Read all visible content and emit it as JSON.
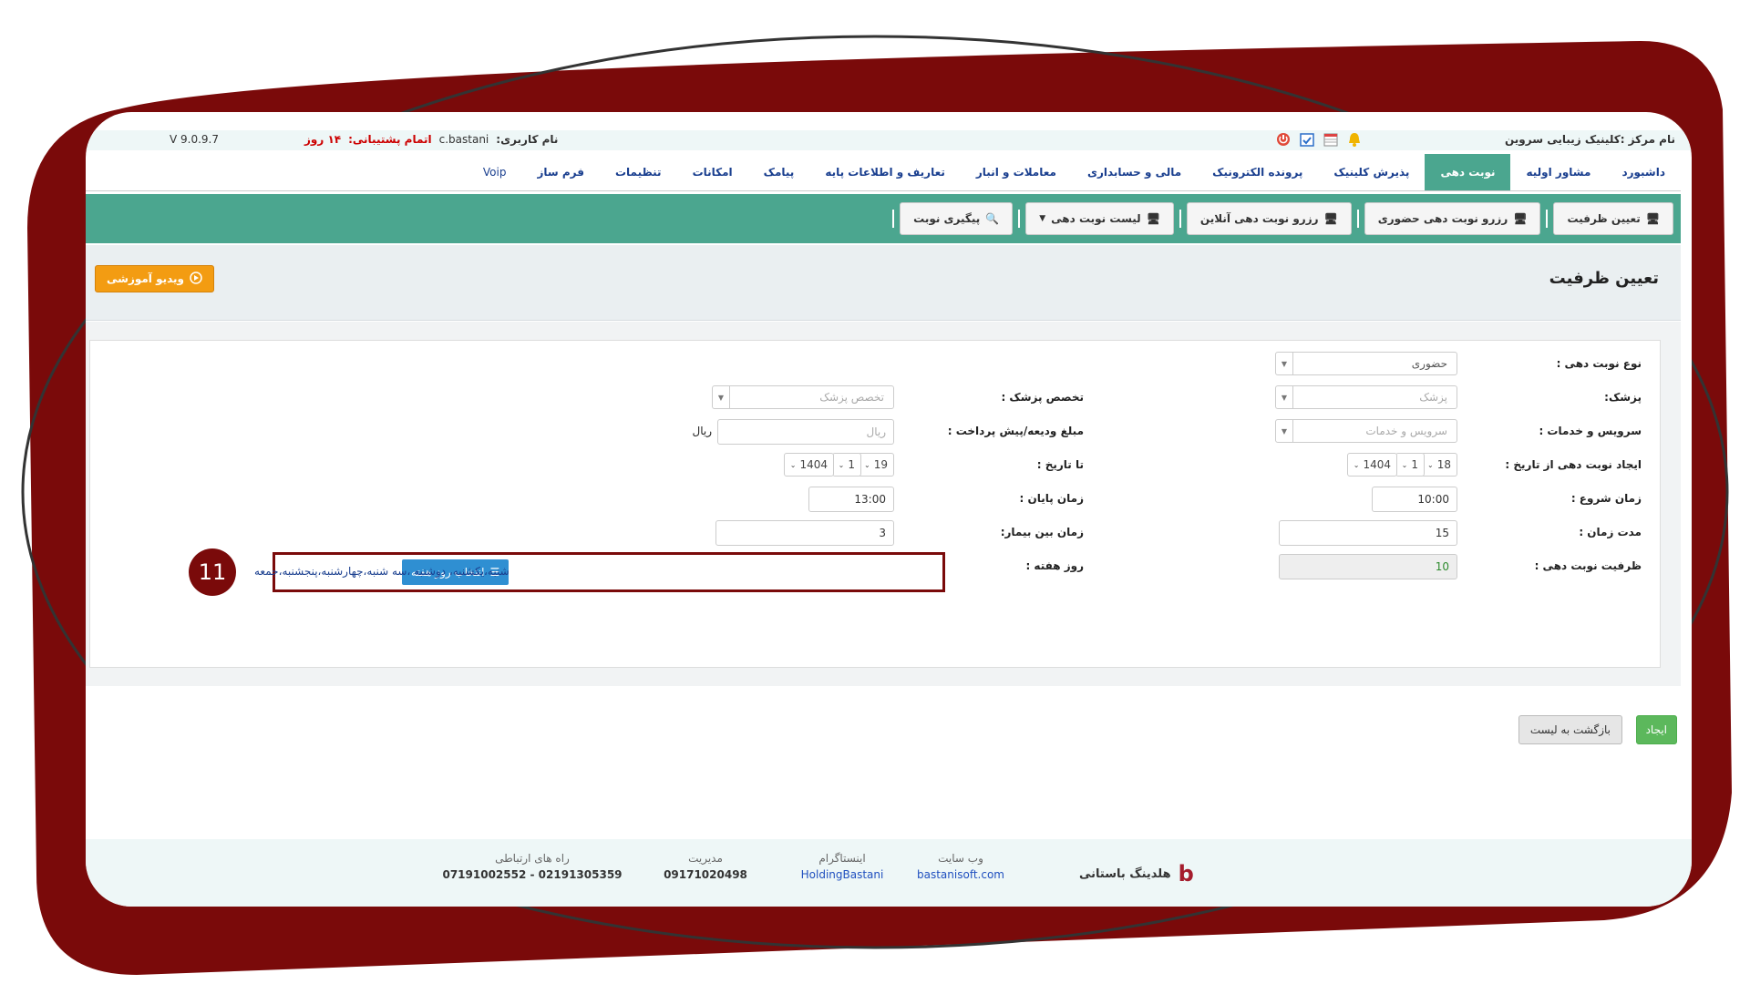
{
  "topbar": {
    "center_label": "نام مرکز :کلینیک زیبایی سروین",
    "user_label": "نام کاربری:",
    "username": "c.bastani",
    "support_label": "اتمام پشتیبانی:",
    "support_value": "۱۴ روز",
    "version": "V 9.0.9.7"
  },
  "main_nav": [
    {
      "label": "داشبورد"
    },
    {
      "label": "مشاور اولیه"
    },
    {
      "label": "نوبت دهی"
    },
    {
      "label": "پذیرش کلینیک"
    },
    {
      "label": "پرونده الکترونیک"
    },
    {
      "label": "مالی و حسابداری"
    },
    {
      "label": "معاملات و انبار"
    },
    {
      "label": "تعاریف و اطلاعات پایه"
    },
    {
      "label": "پیامک"
    },
    {
      "label": "امکانات"
    },
    {
      "label": "تنظیمات"
    },
    {
      "label": "فرم ساز"
    },
    {
      "label": "Voip"
    }
  ],
  "sub_nav": [
    {
      "label": "تعیین ظرفیت"
    },
    {
      "label": "رزرو نوبت دهی حضوری"
    },
    {
      "label": "رزرو نوبت دهی آنلاین"
    },
    {
      "label": "لیست نوبت دهی"
    },
    {
      "label": "پیگیری نوبت"
    }
  ],
  "page": {
    "title": "تعیین ظرفیت",
    "video_button": "ویدیو آموزشی"
  },
  "form": {
    "type_label": "نوع نوبت دهی :",
    "type_value": "حضوری",
    "doctor_label": "پزشک:",
    "doctor_placeholder": "پزشک",
    "specialty_label": "تخصص پزشک :",
    "specialty_placeholder": "تخصص پزشک",
    "services_label": "سرویس و خدمات :",
    "services_placeholder": "سرویس و خدمات",
    "deposit_label": "مبلغ ودیعه/پیش پرداخت :",
    "deposit_placeholder": "ریال",
    "deposit_unit": "ریال",
    "from_date_label": "ایجاد نوبت دهی از تاریخ :",
    "from_day": "18",
    "from_month": "1",
    "from_year": "1404",
    "to_date_label": "تا تاریخ :",
    "to_day": "19",
    "to_month": "1",
    "to_year": "1404",
    "start_time_label": "زمان شروع :",
    "start_time": "10:00",
    "end_time_label": "زمان پایان :",
    "end_time": "13:00",
    "duration_label": "مدت زمان :",
    "duration": "15",
    "between_label": "زمان بین بیمار:",
    "between": "3",
    "capacity_label": "ظرفیت نوبت دهی :",
    "capacity": "10",
    "weekday_label": "روز هفته :",
    "weekday_button": "انتخاب روز هفته",
    "weekday_selected": "شنبه،یکشنبه، دوشنبه ،سه شنبه،چهارشنبه،پنجشنبه،جمعه",
    "step_badge": "11"
  },
  "actions": {
    "create": "ایجاد",
    "back": "بازگشت به لیست"
  },
  "footer": {
    "brand": "هلدینگ باستانی",
    "website_label": "وب سایت",
    "website": "bastanisoft.com",
    "instagram_label": "اینستاگرام",
    "instagram": "HoldingBastani",
    "management_label": "مدیریت",
    "management": "09171020498",
    "contact_label": "راه های ارتباطی",
    "contact": "07191002552 - 02191305359"
  },
  "colors": {
    "frame": "#7a0a0a",
    "accent_green": "#4ba68f",
    "blue_button": "#2f8fd2",
    "orange": "#f39c12"
  }
}
